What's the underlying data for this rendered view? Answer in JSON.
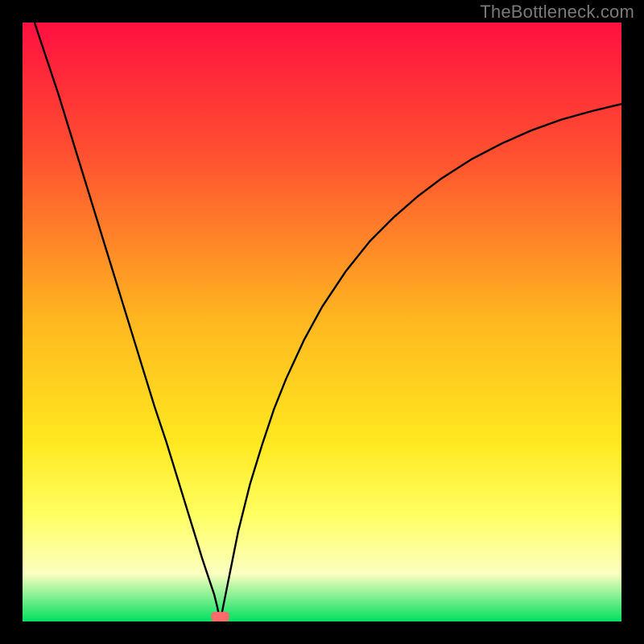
{
  "watermark": "TheBottleneck.com",
  "colors": {
    "border": "#000000",
    "curve": "#000000",
    "gradient_top": "#ff1040",
    "gradient_mid1": "#ff5030",
    "gradient_mid2": "#ffb820",
    "gradient_mid3": "#ffe820",
    "gradient_mid4": "#ffff60",
    "gradient_mid5": "#fcffc0",
    "gradient_bottom": "#00e060",
    "marker": "#ff6a6a"
  },
  "chart_data": {
    "type": "line",
    "title": "",
    "xlabel": "",
    "ylabel": "",
    "xlim": [
      0,
      100
    ],
    "ylim": [
      0,
      100
    ],
    "minimum_x": 33,
    "marker": {
      "x": 33,
      "y": 0,
      "w": 3,
      "h": 1.6
    },
    "series": [
      {
        "name": "bottleneck-curve",
        "x": [
          2,
          4,
          6,
          8,
          10,
          12,
          14,
          16,
          18,
          20,
          22,
          24,
          26,
          28,
          30,
          31,
          32,
          32.5,
          33,
          33.5,
          34,
          35,
          36,
          38,
          40,
          42,
          44,
          47,
          50,
          54,
          58,
          62,
          66,
          70,
          75,
          80,
          85,
          90,
          95,
          100
        ],
        "y": [
          100,
          94,
          88,
          81.5,
          75,
          68.5,
          62,
          55.5,
          49,
          42.5,
          36,
          30,
          23.5,
          17,
          10.5,
          7.5,
          4.5,
          2.5,
          0,
          2.5,
          5,
          10,
          15,
          23,
          29.5,
          35.5,
          40.5,
          47,
          52.5,
          58.5,
          63.5,
          67.5,
          71,
          74,
          77.2,
          79.8,
          82,
          83.8,
          85.2,
          86.4
        ]
      }
    ]
  }
}
